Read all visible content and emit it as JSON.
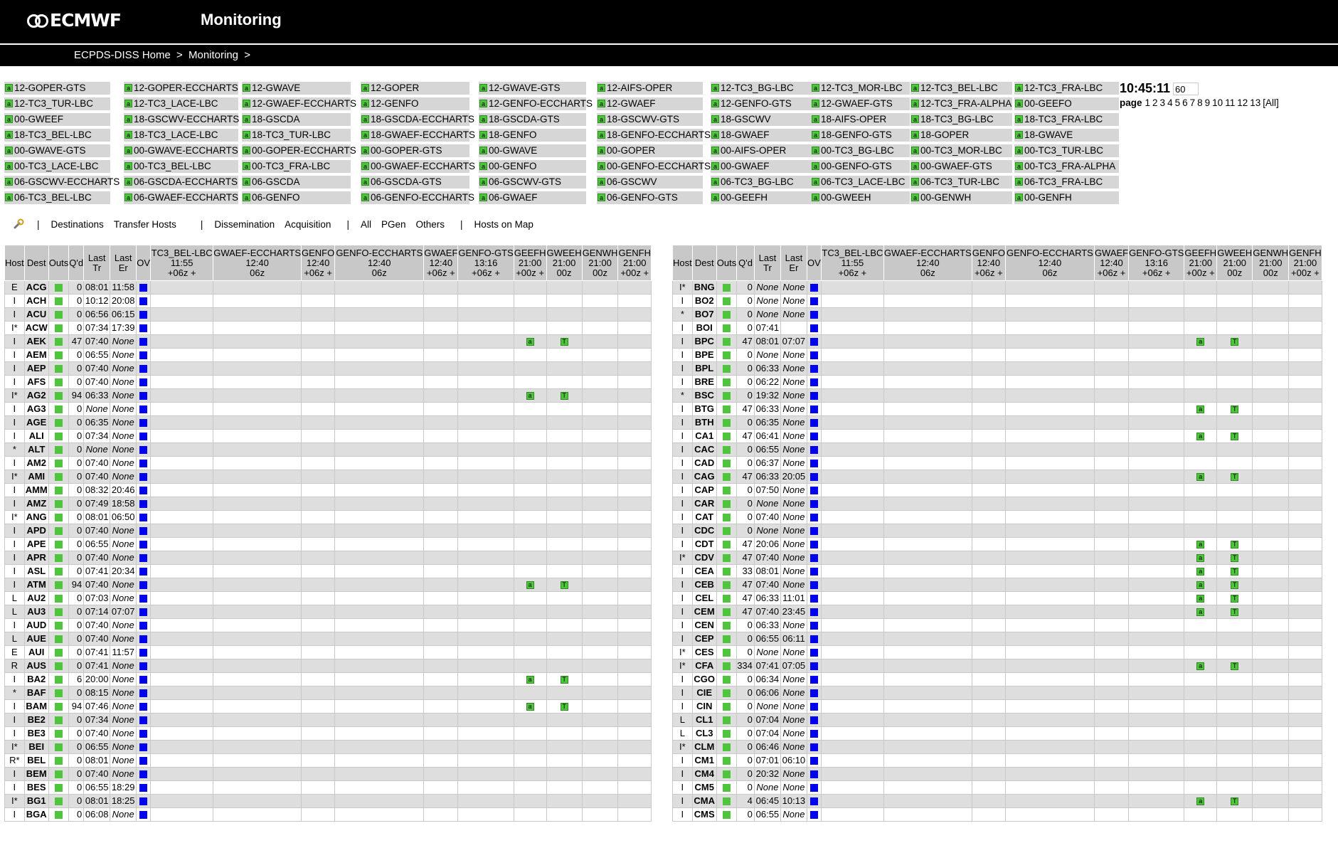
{
  "header": {
    "logo_text": "ECMWF",
    "title": "Monitoring"
  },
  "breadcrumb": {
    "home": "ECPDS-DISS Home",
    "sep": ">",
    "current": "Monitoring",
    "tail": ">"
  },
  "products": [
    [
      "12-GOPER-GTS",
      "12-GOPER-ECCHARTS",
      "12-GWAVE",
      "12-GOPER",
      "12-GWAVE-GTS",
      "12-AIFS-OPER",
      "12-TC3_BG-LBC",
      "12-TC3_MOR-LBC",
      "12-TC3_BEL-LBC",
      "12-TC3_FRA-LBC"
    ],
    [
      "12-TC3_TUR-LBC",
      "12-TC3_LACE-LBC",
      "12-GWAEF-ECCHARTS",
      "12-GENFO",
      "12-GENFO-ECCHARTS",
      "12-GWAEF",
      "12-GENFO-GTS",
      "12-GWAEF-GTS",
      "12-TC3_FRA-ALPHA",
      "00-GEEFO"
    ],
    [
      "00-GWEEF",
      "18-GSCWV-ECCHARTS",
      "18-GSCDA",
      "18-GSCDA-ECCHARTS",
      "18-GSCDA-GTS",
      "18-GSCWV-GTS",
      "18-GSCWV",
      "18-AIFS-OPER",
      "18-TC3_BG-LBC",
      "18-TC3_FRA-LBC"
    ],
    [
      "18-TC3_BEL-LBC",
      "18-TC3_LACE-LBC",
      "18-TC3_TUR-LBC",
      "18-GWAEF-ECCHARTS",
      "18-GENFO",
      "18-GENFO-ECCHARTS",
      "18-GWAEF",
      "18-GENFO-GTS",
      "18-GOPER",
      "18-GWAVE"
    ],
    [
      "00-GWAVE-GTS",
      "00-GWAVE-ECCHARTS",
      "00-GOPER-ECCHARTS",
      "00-GOPER-GTS",
      "00-GWAVE",
      "00-GOPER",
      "00-AIFS-OPER",
      "00-TC3_BG-LBC",
      "00-TC3_MOR-LBC",
      "00-TC3_TUR-LBC"
    ],
    [
      "00-TC3_LACE-LBC",
      "00-TC3_BEL-LBC",
      "00-TC3_FRA-LBC",
      "00-GWAEF-ECCHARTS",
      "00-GENFO",
      "00-GENFO-ECCHARTS",
      "00-GWAEF",
      "00-GENFO-GTS",
      "00-GWAEF-GTS",
      "00-TC3_FRA-ALPHA"
    ],
    [
      "06-GSCWV-ECCHARTS",
      "06-GSCDA-ECCHARTS",
      "06-GSCDA",
      "06-GSCDA-GTS",
      "06-GSCWV-GTS",
      "06-GSCWV",
      "06-TC3_BG-LBC",
      "06-TC3_LACE-LBC",
      "06-TC3_TUR-LBC",
      "06-TC3_FRA-LBC"
    ],
    [
      "06-TC3_BEL-LBC",
      "06-GWAEF-ECCHARTS",
      "06-GENFO",
      "06-GENFO-ECCHARTS",
      "06-GWAEF",
      "06-GENFO-GTS",
      "00-GEEFH",
      "00-GWEEH",
      "00-GENWH",
      "00-GENFH"
    ]
  ],
  "product_icon": "a",
  "clock": "10:45:11",
  "refresh_value": "60",
  "pager": {
    "label": "page",
    "pages": [
      "1",
      "2",
      "3",
      "4",
      "5",
      "6",
      "7",
      "8",
      "9",
      "10",
      "11",
      "12",
      "13",
      "[All]"
    ]
  },
  "toolbar": {
    "icon": "wrench-icon",
    "sep": "|",
    "destinations": "Destinations",
    "transfer_hosts": "Transfer Hosts",
    "dissemination": "Dissemination",
    "acquisition": "Acquisition",
    "all": "All",
    "pgen": "PGen",
    "others": "Others",
    "hosts_on_map": "Hosts on Map"
  },
  "table_headers": {
    "fixed": [
      "Host",
      "Dest",
      "Outs",
      "Q'd",
      "Last Tr",
      "Last Er",
      "OV"
    ],
    "products": [
      {
        "name": "TC3_BEL-LBC",
        "time": "11:55",
        "cycle": "+06z +"
      },
      {
        "name": "GWAEF-ECCHARTS",
        "time": "12:40",
        "cycle": "06z"
      },
      {
        "name": "GENFO",
        "time": "12:40",
        "cycle": "+06z +"
      },
      {
        "name": "GENFO-ECCHARTS",
        "time": "12:40",
        "cycle": "06z"
      },
      {
        "name": "GWAEF",
        "time": "12:40",
        "cycle": "+06z +"
      },
      {
        "name": "GENFO-GTS",
        "time": "13:16",
        "cycle": "+06z +"
      },
      {
        "name": "GEEFH",
        "time": "21:00",
        "cycle": "+00z +"
      },
      {
        "name": "GWEEH",
        "time": "21:00",
        "cycle": "00z"
      },
      {
        "name": "GENWH",
        "time": "21:00",
        "cycle": "00z"
      },
      {
        "name": "GENFH",
        "time": "21:00",
        "cycle": "+00z +"
      }
    ]
  },
  "badge_a": "a",
  "badge_t": "T",
  "left_rows": [
    [
      "E",
      "ACG",
      "0",
      "08:01",
      "11:58",
      0
    ],
    [
      "I",
      "ACH",
      "0",
      "10:12",
      "20:08",
      0
    ],
    [
      "I",
      "ACU",
      "0",
      "06:56",
      "06:15",
      0
    ],
    [
      "I*",
      "ACW",
      "0",
      "07:34",
      "17:39",
      0
    ],
    [
      "I",
      "AEK",
      "47",
      "07:40",
      "None",
      1
    ],
    [
      "I",
      "AEM",
      "0",
      "06:55",
      "None",
      0
    ],
    [
      "I",
      "AEP",
      "0",
      "07:40",
      "None",
      0
    ],
    [
      "I",
      "AFS",
      "0",
      "07:40",
      "None",
      0
    ],
    [
      "I*",
      "AG2",
      "94",
      "06:33",
      "None",
      1
    ],
    [
      "I",
      "AG3",
      "0",
      "None",
      "None",
      0
    ],
    [
      "I",
      "AGE",
      "0",
      "06:35",
      "None",
      0
    ],
    [
      "I",
      "ALI",
      "0",
      "07:34",
      "None",
      0
    ],
    [
      "*",
      "ALT",
      "0",
      "None",
      "None",
      0
    ],
    [
      "I",
      "AM2",
      "0",
      "07:40",
      "None",
      0
    ],
    [
      "I*",
      "AMI",
      "0",
      "07:40",
      "None",
      0
    ],
    [
      "I",
      "AMM",
      "0",
      "08:32",
      "20:46",
      0
    ],
    [
      "I",
      "AMZ",
      "0",
      "07:49",
      "18:58",
      0
    ],
    [
      "I*",
      "ANG",
      "0",
      "08:01",
      "06:50",
      0
    ],
    [
      "I",
      "APD",
      "0",
      "07:40",
      "None",
      0
    ],
    [
      "I",
      "APE",
      "0",
      "06:55",
      "None",
      0
    ],
    [
      "I",
      "APR",
      "0",
      "07:40",
      "None",
      0
    ],
    [
      "I",
      "ASL",
      "0",
      "07:41",
      "20:34",
      0
    ],
    [
      "I",
      "ATM",
      "94",
      "07:40",
      "None",
      1
    ],
    [
      "L",
      "AU2",
      "0",
      "07:03",
      "None",
      0
    ],
    [
      "L",
      "AU3",
      "0",
      "07:14",
      "07:07",
      0
    ],
    [
      "I",
      "AUD",
      "0",
      "07:40",
      "None",
      0
    ],
    [
      "L",
      "AUE",
      "0",
      "07:40",
      "None",
      0
    ],
    [
      "E",
      "AUI",
      "0",
      "07:41",
      "11:57",
      0
    ],
    [
      "R",
      "AUS",
      "0",
      "07:41",
      "None",
      0
    ],
    [
      "I",
      "BA2",
      "6",
      "20:00",
      "None",
      1
    ],
    [
      "*",
      "BAF",
      "0",
      "08:15",
      "None",
      0
    ],
    [
      "I",
      "BAM",
      "94",
      "07:46",
      "None",
      1
    ],
    [
      "I",
      "BE2",
      "0",
      "07:34",
      "None",
      0
    ],
    [
      "I",
      "BE3",
      "0",
      "07:40",
      "None",
      0
    ],
    [
      "I*",
      "BEI",
      "0",
      "06:55",
      "None",
      0
    ],
    [
      "R*",
      "BEL",
      "0",
      "08:01",
      "None",
      0
    ],
    [
      "I",
      "BEM",
      "0",
      "07:40",
      "None",
      0
    ],
    [
      "I",
      "BES",
      "0",
      "06:55",
      "18:29",
      0
    ],
    [
      "I*",
      "BG1",
      "0",
      "08:01",
      "18:25",
      0
    ],
    [
      "I",
      "BGA",
      "0",
      "06:08",
      "None",
      0
    ]
  ],
  "right_rows": [
    [
      "I*",
      "BNG",
      "0",
      "None",
      "None",
      0
    ],
    [
      "I",
      "BO2",
      "0",
      "None",
      "None",
      0
    ],
    [
      "*",
      "BO7",
      "0",
      "None",
      "None",
      0
    ],
    [
      "I",
      "BOI",
      "0",
      "07:41",
      "",
      0
    ],
    [
      "I",
      "BPC",
      "47",
      "08:01",
      "07:07",
      1
    ],
    [
      "I",
      "BPE",
      "0",
      "None",
      "None",
      0
    ],
    [
      "I",
      "BPL",
      "0",
      "06:33",
      "None",
      0
    ],
    [
      "I",
      "BRE",
      "0",
      "06:22",
      "None",
      0
    ],
    [
      "*",
      "BSC",
      "0",
      "19:32",
      "None",
      0
    ],
    [
      "I",
      "BTG",
      "47",
      "06:33",
      "None",
      1
    ],
    [
      "I",
      "BTH",
      "0",
      "06:35",
      "None",
      0
    ],
    [
      "I",
      "CA1",
      "47",
      "06:41",
      "None",
      1
    ],
    [
      "I",
      "CAC",
      "0",
      "06:55",
      "None",
      0
    ],
    [
      "I",
      "CAD",
      "0",
      "06:37",
      "None",
      0
    ],
    [
      "I",
      "CAG",
      "47",
      "06:33",
      "20:05",
      1
    ],
    [
      "I",
      "CAP",
      "0",
      "07:50",
      "None",
      0
    ],
    [
      "I",
      "CAR",
      "0",
      "None",
      "None",
      0
    ],
    [
      "I",
      "CAT",
      "0",
      "07:40",
      "None",
      0
    ],
    [
      "I",
      "CDC",
      "0",
      "None",
      "None",
      0
    ],
    [
      "I",
      "CDT",
      "47",
      "20:06",
      "None",
      1
    ],
    [
      "I*",
      "CDV",
      "47",
      "07:40",
      "None",
      1
    ],
    [
      "I",
      "CEA",
      "33",
      "08:01",
      "None",
      1
    ],
    [
      "I",
      "CEB",
      "47",
      "07:40",
      "None",
      1
    ],
    [
      "I",
      "CEL",
      "47",
      "06:33",
      "11:01",
      1
    ],
    [
      "I",
      "CEM",
      "47",
      "07:40",
      "23:45",
      1
    ],
    [
      "I",
      "CEN",
      "0",
      "06:33",
      "None",
      0
    ],
    [
      "I",
      "CEP",
      "0",
      "06:55",
      "06:11",
      0
    ],
    [
      "I*",
      "CES",
      "0",
      "None",
      "None",
      0
    ],
    [
      "I*",
      "CFA",
      "334",
      "07:41",
      "07:05",
      1
    ],
    [
      "I",
      "CGO",
      "0",
      "06:34",
      "None",
      0
    ],
    [
      "I",
      "CIE",
      "0",
      "06:06",
      "None",
      0
    ],
    [
      "I",
      "CIN",
      "0",
      "None",
      "None",
      0
    ],
    [
      "L",
      "CL1",
      "0",
      "07:04",
      "None",
      0
    ],
    [
      "L",
      "CL3",
      "0",
      "07:04",
      "None",
      0
    ],
    [
      "I*",
      "CLM",
      "0",
      "06:46",
      "None",
      0
    ],
    [
      "I",
      "CM1",
      "0",
      "07:01",
      "06:10",
      0
    ],
    [
      "I",
      "CM4",
      "0",
      "20:32",
      "None",
      0
    ],
    [
      "I",
      "CM5",
      "0",
      "None",
      "None",
      0
    ],
    [
      "I",
      "CMA",
      "4",
      "06:45",
      "10:13",
      1
    ],
    [
      "I",
      "CMS",
      "0",
      "06:55",
      "None",
      0
    ]
  ]
}
